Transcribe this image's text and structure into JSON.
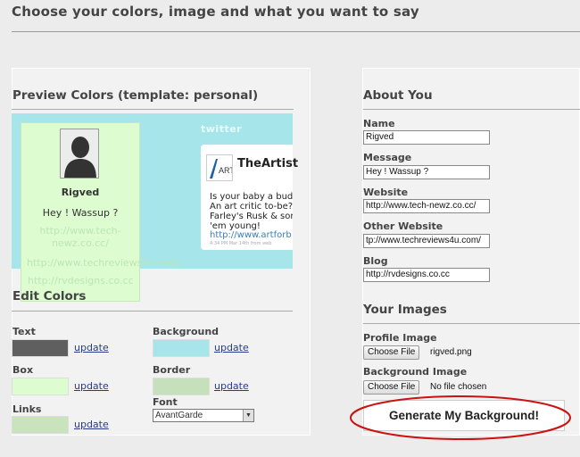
{
  "page": {
    "title": "Choose your colors, image and what you want to say"
  },
  "preview": {
    "heading": "Preview Colors (template: personal)",
    "sidebar": {
      "name": "Rigved",
      "message": "Hey ! Wassup ?",
      "website": "http://www.tech-newz.co.cc/",
      "other_website": "http://www.techreviews4u.com",
      "blog": "http://rvdesigns.co.cc"
    },
    "twitter_logo": "twitter",
    "tweet": {
      "brand_mark": "ART",
      "account_name": "TheArtist",
      "lines": [
        "Is your baby a bud",
        "An art critic to-be?",
        "Farley's Rusk & som",
        "'em young!"
      ],
      "link": "http://www.artforb",
      "meta": "4:34 PM Mar 14th from web"
    }
  },
  "edit_colors": {
    "heading": "Edit Colors",
    "update_label": "update",
    "text_label": "Text",
    "background_label": "Background",
    "box_label": "Box",
    "border_label": "Border",
    "links_label": "Links",
    "font_label": "Font",
    "font_value": "AvantGarde",
    "colors": {
      "text": "#5f5f5f",
      "background": "#a6e6ea",
      "box": "#ddfcd0",
      "border": "#c6e0bb",
      "links": "#c9e3bc"
    }
  },
  "about_you": {
    "heading": "About You",
    "name_label": "Name",
    "name_value": "Rigved",
    "message_label": "Message",
    "message_value": "Hey ! Wassup ?",
    "website_label": "Website",
    "website_value": "http://www.tech-newz.co.cc/",
    "other_website_label": "Other Website",
    "other_website_value": "tp://www.techreviews4u.com/",
    "blog_label": "Blog",
    "blog_value": "http://rvdesigns.co.cc"
  },
  "your_images": {
    "heading": "Your Images",
    "profile_label": "Profile Image",
    "profile_button": "Choose File",
    "profile_file": "rigved.png",
    "background_label": "Background Image",
    "background_button": "Choose File",
    "background_file": "No file chosen"
  },
  "generate": {
    "label": "Generate My Background!",
    "highlight_color": "#cc1111"
  }
}
